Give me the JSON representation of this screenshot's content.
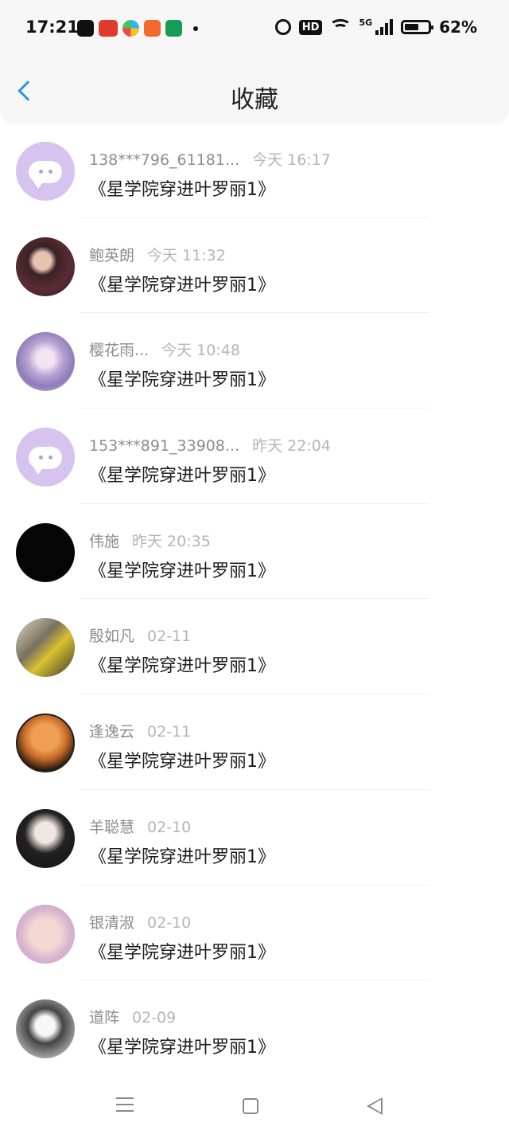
{
  "status_bar": {
    "time": "17:21",
    "hd_label": "HD",
    "network_label": "5G",
    "battery": "62%",
    "battery_level": 0.62
  },
  "header": {
    "title": "收藏"
  },
  "favorites": [
    {
      "user": "138***796_61181...",
      "time": "今天 16:17",
      "title": "《星学院穿进叶罗丽1》"
    },
    {
      "user": "鲍英朗",
      "time": "今天 11:32",
      "title": "《星学院穿进叶罗丽1》"
    },
    {
      "user": "樱花雨...",
      "time": "今天 10:48",
      "title": "《星学院穿进叶罗丽1》"
    },
    {
      "user": "153***891_33908...",
      "time": "昨天 22:04",
      "title": "《星学院穿进叶罗丽1》"
    },
    {
      "user": "伟施",
      "time": "昨天 20:35",
      "title": "《星学院穿进叶罗丽1》"
    },
    {
      "user": "殷如凡",
      "time": "02-11",
      "title": "《星学院穿进叶罗丽1》"
    },
    {
      "user": "逢逸云",
      "time": "02-11",
      "title": "《星学院穿进叶罗丽1》"
    },
    {
      "user": "羊聪慧",
      "time": "02-10",
      "title": "《星学院穿进叶罗丽1》"
    },
    {
      "user": "银清淑",
      "time": "02-10",
      "title": "《星学院穿进叶罗丽1》"
    },
    {
      "user": "道阵",
      "time": "02-09",
      "title": "《星学院穿进叶罗丽1》"
    }
  ],
  "colors": {
    "accent": "#2a96e8",
    "placeholder_avatar": "#d6c3f0"
  }
}
